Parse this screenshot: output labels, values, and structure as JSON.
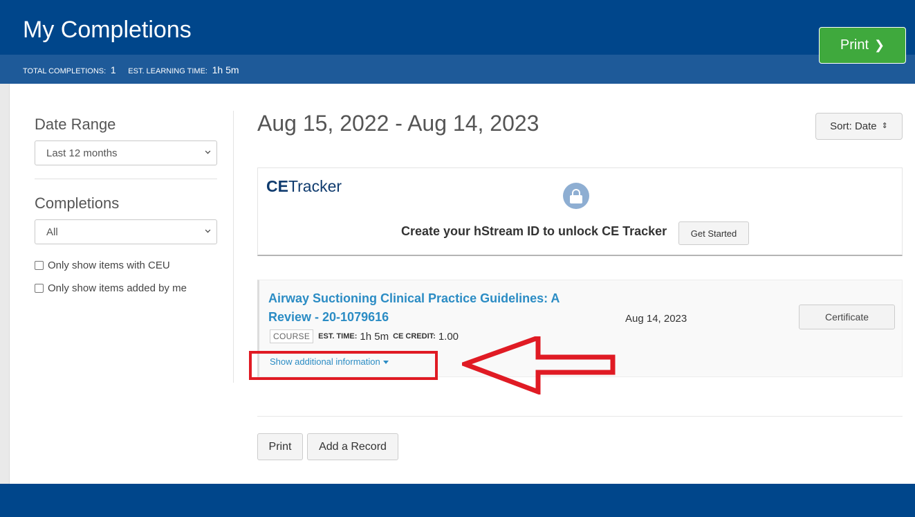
{
  "header": {
    "title": "My Completions",
    "stats": {
      "total_label": "TOTAL COMPLETIONS:",
      "total_value": "1",
      "time_label": "EST. LEARNING TIME:",
      "time_value": "1h 5m"
    },
    "print_label": "Print",
    "print_chevron": "❯"
  },
  "sidebar": {
    "date_range_heading": "Date Range",
    "date_range_value": "Last 12 months",
    "completions_heading": "Completions",
    "completions_value": "All",
    "checkboxes": [
      {
        "label": "Only show items with CEU",
        "checked": false
      },
      {
        "label": "Only show items added by me",
        "checked": false
      }
    ]
  },
  "main": {
    "range_title": "Aug 15, 2022 - Aug 14, 2023",
    "sort_label": "Sort: Date",
    "sort_icon": "⇕",
    "ce_tracker": {
      "logo_bold": "CE",
      "logo_light": "Tracker",
      "icon": "lock-icon",
      "message": "Create your hStream ID to unlock CE Tracker",
      "button_label": "Get Started"
    },
    "records": [
      {
        "title": "Airway Suctioning Clinical Practice Guidelines: A Review - 20-1079616",
        "type_badge": "COURSE",
        "est_time_label": "EST. TIME:",
        "est_time_value": "1h 5m",
        "credit_label": "CE CREDIT:",
        "credit_value": "1.00",
        "show_more_label": "Show additional information",
        "date": "Aug 14, 2023",
        "certificate_label": "Certificate"
      }
    ],
    "print_label": "Print",
    "add_record_label": "Add a Record"
  },
  "colors": {
    "header_bg": "#00468b",
    "header_bar": "#1e5a99",
    "print_button": "#3fa93d",
    "link": "#2b8cc4",
    "annotation_red": "#e01b24"
  }
}
